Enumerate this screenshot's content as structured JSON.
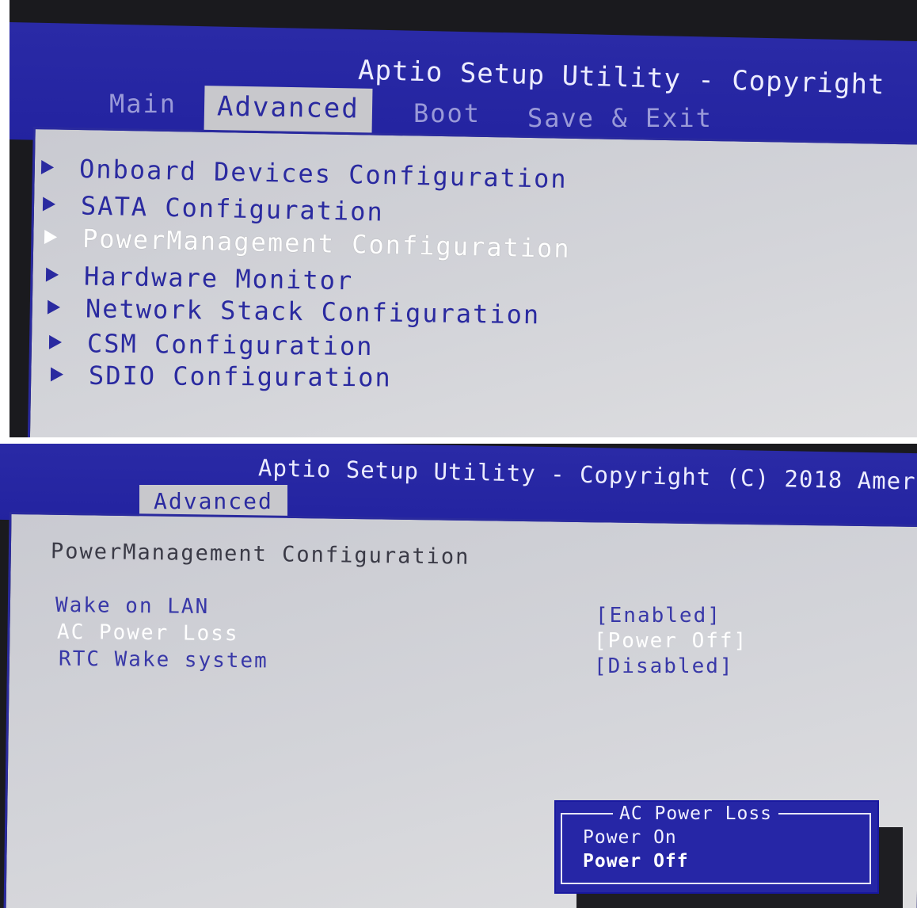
{
  "top_screen": {
    "title": "Aptio Setup Utility - Copyright",
    "tabs": [
      {
        "label": "Main",
        "active": false
      },
      {
        "label": "Advanced",
        "active": true
      },
      {
        "label": "Boot",
        "active": false
      },
      {
        "label": "Save & Exit",
        "active": false
      }
    ],
    "menu_items": [
      {
        "label": "Onboard Devices Configuration",
        "selected": false
      },
      {
        "label": "SATA Configuration",
        "selected": false
      },
      {
        "label": "PowerManagement Configuration",
        "selected": true
      },
      {
        "label": "Hardware Monitor",
        "selected": false
      },
      {
        "label": "Network Stack Configuration",
        "selected": false
      },
      {
        "label": "CSM Configuration",
        "selected": false
      },
      {
        "label": "SDIO Configuration",
        "selected": false
      }
    ]
  },
  "bottom_screen": {
    "title": "Aptio Setup Utility - Copyright (C) 2018 Amer",
    "active_tab": "Advanced",
    "section_title": "PowerManagement Configuration",
    "settings": [
      {
        "label": "Wake on LAN",
        "value": "[Enabled]",
        "selected": false
      },
      {
        "label": "AC Power Loss",
        "value": "[Power Off]",
        "selected": true
      },
      {
        "label": "RTC Wake system",
        "value": "[Disabled]",
        "selected": false
      }
    ],
    "popup": {
      "title": "AC Power Loss",
      "options": [
        {
          "label": "Power On",
          "selected": false
        },
        {
          "label": "Power Off",
          "selected": true
        }
      ]
    }
  },
  "colors": {
    "header_blue": "#2323a0",
    "text_blue": "#2a2aa0",
    "panel_gray": "#d3d4d9",
    "highlight_white": "#ffffff"
  },
  "icons": {
    "submenu_arrow": "right-triangle-icon"
  }
}
